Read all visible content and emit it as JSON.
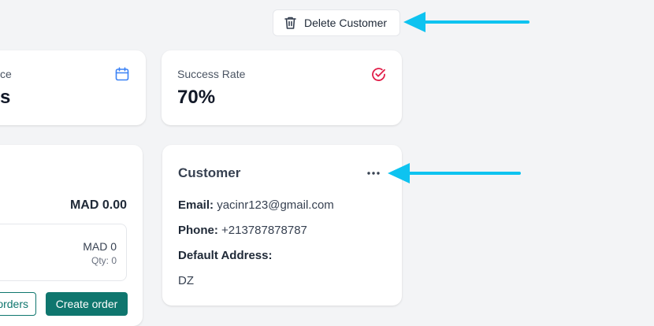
{
  "header": {
    "delete_label": "Delete Customer"
  },
  "stats": [
    {
      "label": "ce",
      "value": "s",
      "icon": "calendar-icon",
      "icon_color": "#3b82f6"
    },
    {
      "label": "Success Rate",
      "value": "70%",
      "icon": "check-circle-icon",
      "icon_color": "#e11d48"
    }
  ],
  "orders": {
    "total": "MAD 0.00",
    "item_price": "MAD 0",
    "item_qty": "Qty: 0",
    "view_orders_label": "orders",
    "create_order_label": "Create order"
  },
  "customer": {
    "title": "Customer",
    "email_label": "Email:",
    "email": "yacinr123@gmail.com",
    "phone_label": "Phone:",
    "phone": "+213787878787",
    "address_label": "Default Address:",
    "address": "DZ"
  },
  "colors": {
    "accent": "#0f766e",
    "annotation_arrow": "#0ec3f0"
  }
}
